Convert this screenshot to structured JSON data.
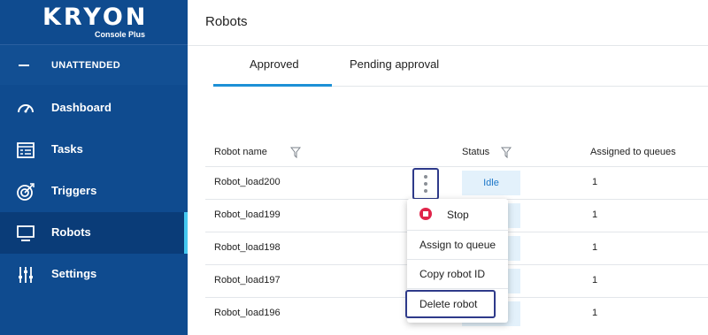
{
  "app": {
    "logo_main": "KRYON",
    "logo_sub": "Console Plus"
  },
  "sidebar": {
    "section_label": "UNATTENDED",
    "items": [
      {
        "label": "Dashboard",
        "icon": "gauge-icon"
      },
      {
        "label": "Tasks",
        "icon": "tasks-icon"
      },
      {
        "label": "Triggers",
        "icon": "target-icon"
      },
      {
        "label": "Robots",
        "icon": "monitor-icon"
      },
      {
        "label": "Settings",
        "icon": "sliders-icon"
      }
    ],
    "active": "Robots"
  },
  "header": {
    "title": "Robots"
  },
  "tabs": [
    {
      "label": "Approved"
    },
    {
      "label": "Pending approval"
    }
  ],
  "table": {
    "columns": {
      "name": "Robot name",
      "status": "Status",
      "queues": "Assigned to queues"
    },
    "rows": [
      {
        "name": "Robot_load200",
        "status": "Idle",
        "queues": "1"
      },
      {
        "name": "Robot_load199",
        "status": "",
        "queues": "1"
      },
      {
        "name": "Robot_load198",
        "status": "",
        "queues": "1"
      },
      {
        "name": "Robot_load197",
        "status": "",
        "queues": "1"
      },
      {
        "name": "Robot_load196",
        "status": "",
        "queues": "1"
      }
    ]
  },
  "context_menu": {
    "stop": "Stop",
    "assign": "Assign to queue",
    "copy": "Copy robot ID",
    "delete": "Delete robot"
  },
  "colors": {
    "sidebar": "#0f4b8f",
    "accent": "#1e90d6",
    "stop": "#e0244a"
  }
}
